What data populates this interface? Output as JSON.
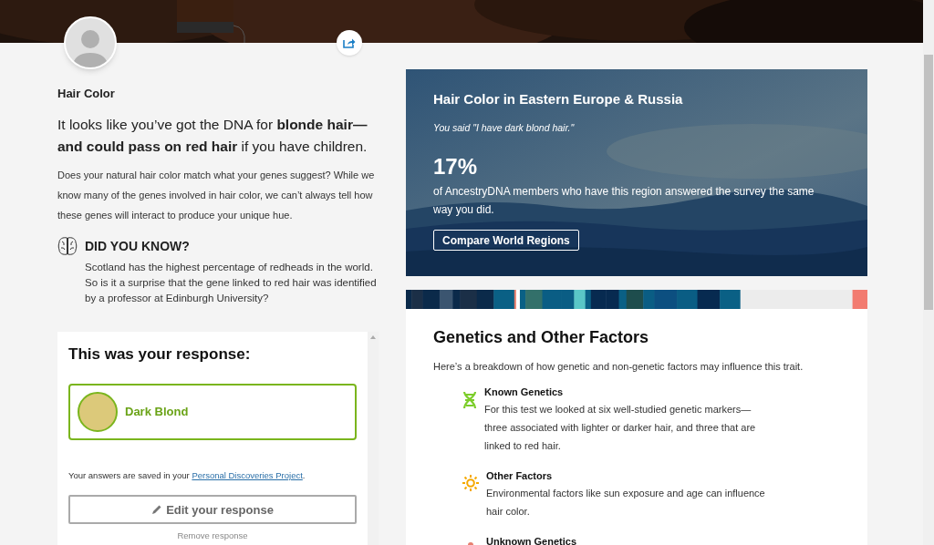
{
  "trait": {
    "title": "Hair Color",
    "headline": "It looks like you’ve got the DNA for **blonde hair—and could pass on red hair** if you have children.",
    "description": "Does your natural hair color match what your genes suggest? While we know many of the genes involved in hair color, we can’t always tell how these genes will interact to produce your unique hue."
  },
  "did_you_know": {
    "heading": "DID YOU KNOW?",
    "text": "Scotland has the highest percentage of redheads in the world. So is it a surprise that the gene linked to red hair was identified by a professor at Edinburgh University?"
  },
  "response": {
    "heading": "This was your response:",
    "option": {
      "label": "Dark Blond",
      "selected": true
    },
    "note_prefix": "Your answers are saved in your ",
    "note_link": "Personal Discoveries Project",
    "note_suffix": ".",
    "edit_button": "Edit your response",
    "remove_link": "Remove response"
  },
  "region_card": {
    "title": "Hair Color in Eastern Europe & Russia",
    "quote": "You said \"I have dark blond hair.\"",
    "percent": "17%",
    "caption": "of AncestryDNA members who have this region answered the survey the same way you did.",
    "button": "Compare World Regions"
  },
  "factors": {
    "heading": "Genetics and Other Factors",
    "intro": "Here’s a breakdown of how genetic and non-genetic factors may influence this trait.",
    "items": [
      {
        "kind": "dna",
        "title": "Known Genetics",
        "text": "For this test we looked at six well-studied genetic markers—three associated with lighter or darker hair, and three that are linked to red hair."
      },
      {
        "kind": "sun",
        "title": "Other Factors",
        "text": "Environmental factors like sun exposure and age can influence hair color."
      },
      {
        "kind": "unknown",
        "title": "Unknown Genetics"
      }
    ]
  }
}
